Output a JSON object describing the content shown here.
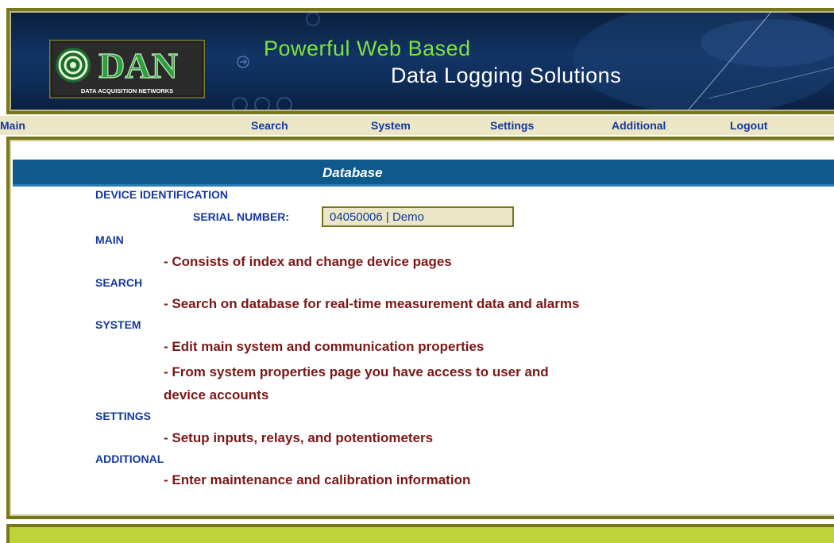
{
  "banner": {
    "logo_text": "DAN",
    "logo_subtext": "DATA ACQUISITION NETWORKS",
    "title_line_1": "Powerful Web Based",
    "title_line_2": "Data Logging Solutions"
  },
  "nav": {
    "main": "Main",
    "search": "Search",
    "system": "System",
    "settings": "Settings",
    "additional": "Additional",
    "logout": "Logout"
  },
  "page": {
    "title": "Database",
    "device_identification": "DEVICE IDENTIFICATION",
    "serial_label": "SERIAL NUMBER:",
    "serial_value": "04050006 | Demo",
    "sections": [
      {
        "label": "MAIN",
        "lines": [
          "- Consists of index and change device pages"
        ]
      },
      {
        "label": "SEARCH",
        "lines": [
          "- Search on database for real-time measurement data and alarms"
        ]
      },
      {
        "label": "SYSTEM",
        "lines": [
          "- Edit main system and communication properties",
          "- From system properties page you have access to user and",
          "device accounts"
        ]
      },
      {
        "label": "SETTINGS",
        "lines": [
          "- Setup inputs, relays, and potentiometers"
        ]
      },
      {
        "label": "ADDITIONAL",
        "lines": [
          "- Enter maintenance and calibration information"
        ]
      }
    ]
  },
  "colors": {
    "frame": "#77771a",
    "nav_bg": "#eae6c6",
    "label_blue": "#15389c",
    "desc_red": "#7a1717",
    "title_bar": "#0f5a8c",
    "banner_green": "#7fe23e",
    "footer_green": "#bed23a"
  }
}
